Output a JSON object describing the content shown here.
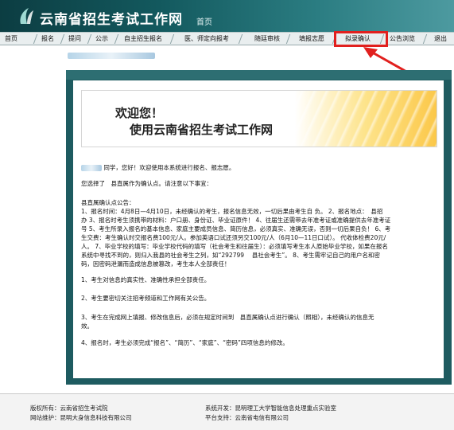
{
  "header": {
    "site_title": "云南省招生考试工作网",
    "home_sub": "首页"
  },
  "nav": {
    "items": [
      "首页",
      "报名",
      "提问",
      "公示",
      "自主招生报名",
      "医、师定向报考",
      "随廷审核",
      "填报志愿",
      "拟录确认",
      "公告浏览",
      "退出"
    ]
  },
  "banner": {
    "welcome_line1": "欢迎您！",
    "welcome_line2": "使用云南省招生考试工作网"
  },
  "content": {
    "greeting": "同学，您好！欢迎使用本系统进行报名、报志愿。",
    "confirm_point": "您选择了　县直属作为确认点。请注意以下事宜：",
    "notice_title": "县直属确认点公告：",
    "notice_lines": [
      "1、报名时间：4月8日—4月10日，未经确认的考生，报名信息无效，一切后果由考生自 负。 2、报名地点：　县招",
      "办 3、报名时考生须携带的材料：户口册、身份证、毕业证原件！ 4、往届生还需带去年准考证或准确提供去年准考证",
      "号 5、考生所录入报名的基本信息、家庭主要成员信息、简历信息，必须真实、准确无误，否则一切后果自负！ 6、考",
      "生交费：考生确认时交报名费100元/人。参加英语口试还须另交100元/人（6月10—11日口试）。 代收体检费20元/",
      "人。 7、毕业学校的填写：毕业学校代码的填写（社会考生和往届生）：必须填写考生本人原始毕业学校，如果在报名",
      "系统中寻找不到的，则归入我县的社会考生之列，如“292799 　县社会考生”。 8、考生需牢记自己的用户名和密",
      "码，因密码泄漏而造成信息被篡改，考生本人全部责任！"
    ],
    "item1": "1、考生对信息的真实性、准确性承担全部责任。",
    "item2": "2、考生要密切关注招考频道和工作网有关公告。",
    "item3_line1": "3、考生在完成网上填报、修改信息后，必须在规定时间到　县直属确认点进行确认（照相），未经确认的信息无",
    "item3_line2": "效。",
    "item4": "4、报名时，考生必须完成“报名”、“简历”、“家庭”、“密码”四项信息的修改。"
  },
  "footer": {
    "copyright": "版权所有：云南省招生考试院",
    "maintainer": "网站维护：昆明大身信息科技有限公司",
    "developer": "系统开发：昆明理工大学智能信息处理重点实验室",
    "platform": "平台支持：云南省电信有限公司"
  },
  "colors": {
    "header_dark": "#0c3d42",
    "panel": "#1e5b60",
    "highlight_red": "#e1201e"
  }
}
